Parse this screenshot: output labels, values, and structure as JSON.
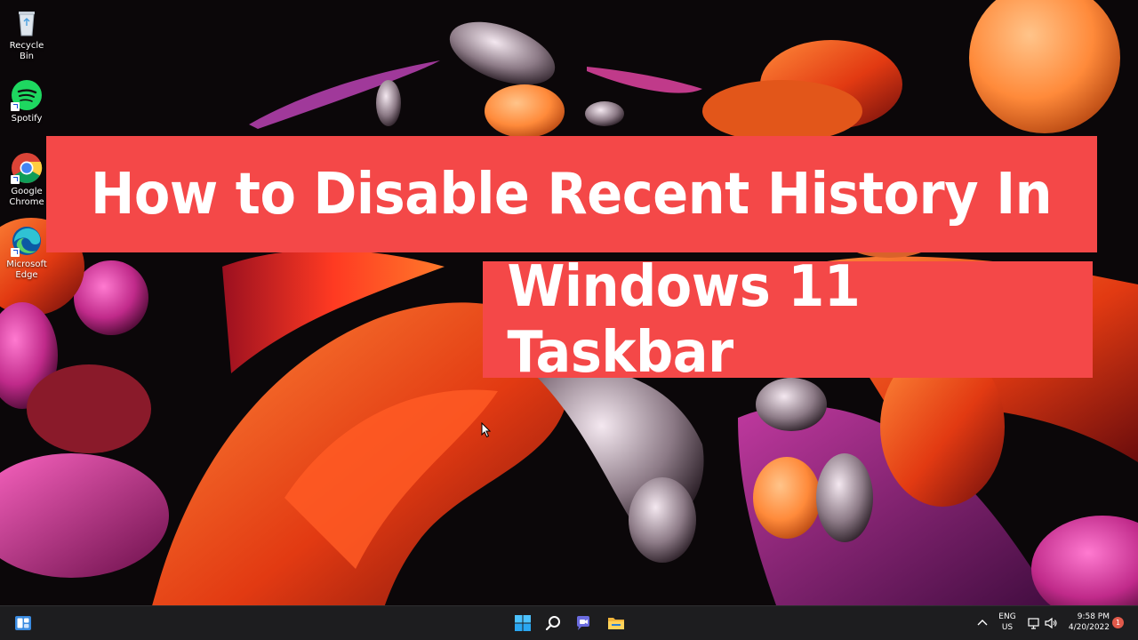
{
  "desktop": {
    "icons": [
      {
        "label": "Recycle Bin"
      },
      {
        "label": "Spotify"
      },
      {
        "label": "Google\nChrome"
      },
      {
        "label": "Microsoft\nEdge"
      }
    ]
  },
  "banner": {
    "line1": "How to Disable Recent History In",
    "line2": "Windows 11 Taskbar",
    "color": "#f44848"
  },
  "taskbar": {
    "language_line1": "ENG",
    "language_line2": "US",
    "time": "9:58 PM",
    "date": "4/20/2022",
    "notification_count": "1",
    "icons": [
      "widgets-icon",
      "windows-start-icon",
      "search-icon",
      "chat-icon",
      "file-explorer-icon",
      "chevron-up-icon",
      "network-icon",
      "volume-icon"
    ]
  }
}
